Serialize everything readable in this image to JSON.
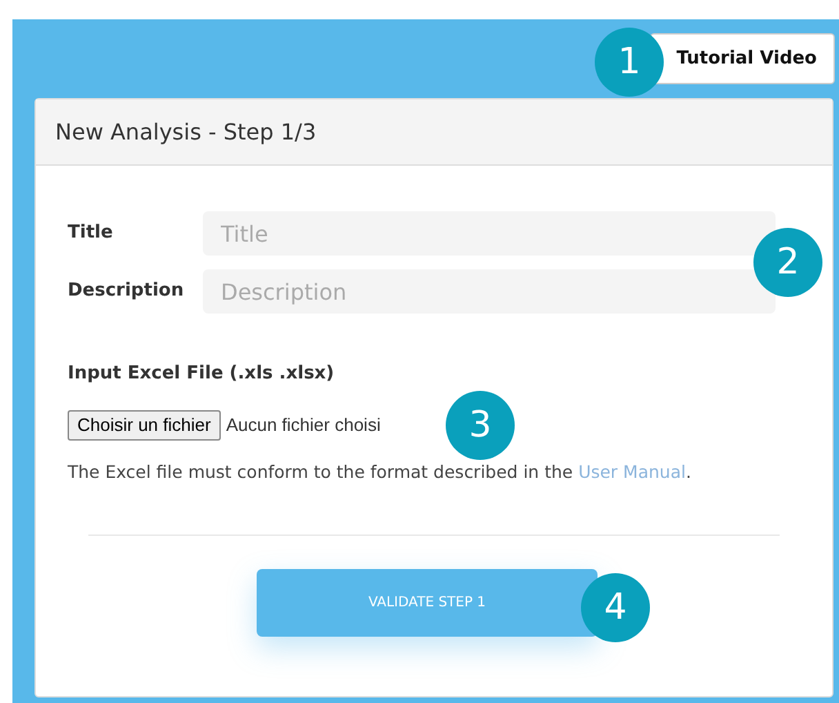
{
  "tutorial_button": {
    "label": "Tutorial Video",
    "badge": "1"
  },
  "card": {
    "title": "New Analysis - Step 1/3"
  },
  "fields": [
    {
      "label": "Title",
      "placeholder": "Title"
    },
    {
      "label": "Description",
      "placeholder": "Description"
    }
  ],
  "fields_badge": "2",
  "file_input": {
    "label": "Input Excel File (.xls .xlsx)",
    "button": "Choisir un fichier",
    "status": "Aucun fichier choisi",
    "badge": "3"
  },
  "help": {
    "text": "The Excel file must conform to the format described in the",
    "link": "User Manual",
    "end": "."
  },
  "validate_button": {
    "label": "VALIDATE STEP 1",
    "badge": "4"
  }
}
